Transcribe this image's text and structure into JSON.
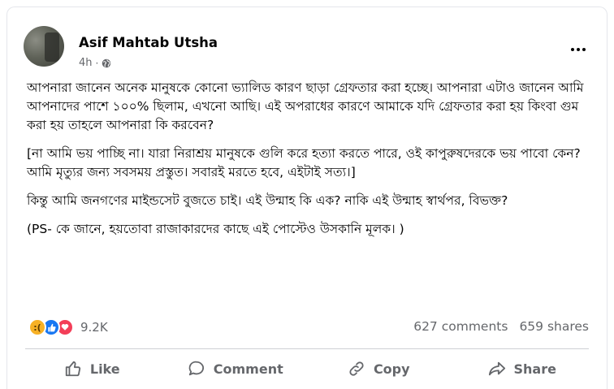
{
  "post": {
    "author": "Asif Mahtab Utsha",
    "time": "4h",
    "privacy_icon": "globe-icon",
    "paragraphs": [
      "আপনারা জানেন অনেক মানুষকে কোনো ভ্যালিড কারণ ছাড়া গ্রেফতার করা হচ্ছে। আপনারা এটাও জানেন আমি আপনাদের পাশে ১০০% ছিলাম, এখনো আছি। এই অপরাধের কারণে আমাকে যদি গ্রেফতার করা হয় কিংবা গুম করা হয় তাহলে আপনারা কি করবেন?",
      "[না আমি ভয় পাচ্ছি না। যারা নিরাশ্রয় মানুষকে গুলি করে হত্যা করতে পারে, ওই কাপুরুষদেরকে ভয় পাবো কেন? আমি মৃত্যুর জন্য সবসময় প্রস্তুত। সবারই মরতে হবে, এইটাই সত্য।]",
      "কিন্তু আমি জনগণের মাইন্ডসেট বুজতে চাই। এই উন্মাহ কি এক? নাকি এই উন্মাহ স্বার্থপর, বিভক্ত?",
      "(PS- কে জানে, হয়তোবা রাজাকারদের কাছে এই পোস্টেও উসকানি মূলক। )"
    ]
  },
  "reactions": {
    "icons": [
      "sad-reaction-icon",
      "like-reaction-icon",
      "love-reaction-icon"
    ],
    "count": "9.2K"
  },
  "stats": {
    "comments": "627 comments",
    "shares": "659 shares"
  },
  "actions": {
    "like": "Like",
    "comment": "Comment",
    "copy": "Copy",
    "share": "Share"
  },
  "colors": {
    "secondary_text": "#65676b",
    "like_blue": "#1877f2",
    "love_red": "#f33e58",
    "sad_yellow": "#f7b125"
  }
}
